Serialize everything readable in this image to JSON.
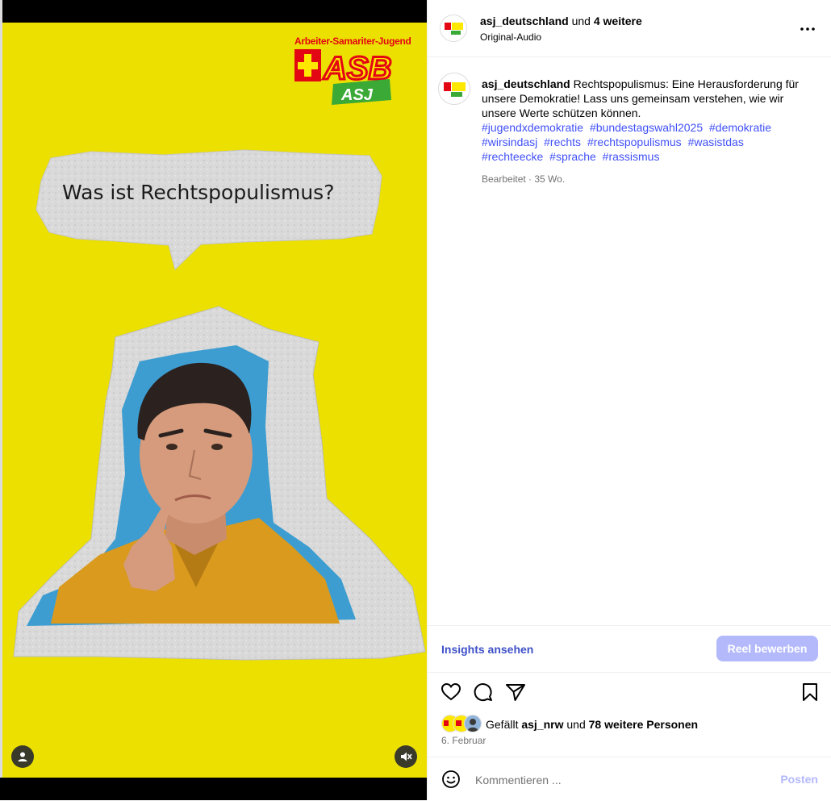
{
  "video": {
    "brand_tagline": "Arbeiter-Samariter-Jugend",
    "brand_logo_main": "ASB",
    "brand_logo_sub": "ASJ",
    "brand_cross_letter": "S",
    "speech_bubble_text": "Was ist Rechtspopulismus?",
    "profile_button_icon": "person-icon",
    "mute_button_icon": "speaker-muted-icon",
    "background_color": "#ece000"
  },
  "header": {
    "username": "asj_deutschland",
    "and_text": "und",
    "collaborators": "4 weitere",
    "audio_label": "Original-Audio",
    "more_icon": "more-horizontal-icon"
  },
  "caption": {
    "username": "asj_deutschland",
    "text": "Rechtspopulismus: Eine Herausforderung für unsere Demokratie! Lass uns gemeinsam verstehen, wie wir unsere Werte schützen können.",
    "hashtags": [
      "#jugendxdemokratie",
      "#bundestagswahl2025",
      "#demokratie",
      "#wirsindasj",
      "#rechts",
      "#rechtspopulismus",
      "#wasistdas",
      "#rechteecke",
      "#sprache",
      "#rassismus"
    ],
    "edited": "Bearbeitet",
    "age": "35 Wo."
  },
  "insights": {
    "link_label": "Insights ansehen",
    "promote_label": "Reel bewerben"
  },
  "actions": {
    "like_icon": "heart-icon",
    "comment_icon": "comment-icon",
    "share_icon": "share-icon",
    "save_icon": "bookmark-icon"
  },
  "likes": {
    "prefix": "Gefällt",
    "user": "asj_nrw",
    "and": "und",
    "others": "78 weitere Personen"
  },
  "date": "6. Februar",
  "comment": {
    "placeholder": "Kommentieren ...",
    "post_label": "Posten",
    "emoji_icon": "smiley-icon"
  },
  "colors": {
    "link_blue": "#4150f7",
    "button_disabled": "#b3b9fb",
    "asb_red": "#e30613",
    "asj_green": "#3aa935"
  }
}
